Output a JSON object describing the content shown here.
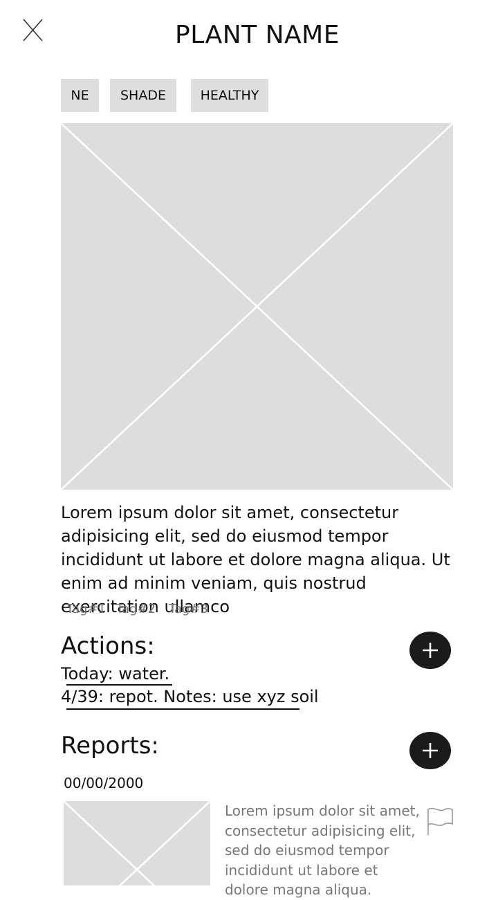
{
  "header": {
    "title": "PLANT NAME",
    "close_icon": "close-icon"
  },
  "status_chips": [
    "NE",
    "SHADE",
    "HEALTHY"
  ],
  "description": "Lorem ipsum dolor sit amet, consectetur adipisicing elit, sed do eiusmod tempor incididunt ut labore et dolore magna aliqua. Ut enim ad minim veniam, quis nostrud exercitation ullamco",
  "tags": [
    "Tag#1",
    "Tag#2",
    "Tag#3"
  ],
  "actions": {
    "title": "Actions:",
    "add_icon": "plus-icon",
    "items": [
      "Today: water.",
      "4/39: repot. Notes: use xyz soil"
    ]
  },
  "reports": {
    "title": "Reports:",
    "add_icon": "plus-icon",
    "items": [
      {
        "date": "00/00/2000",
        "text": "Lorem ipsum dolor sit amet, consectetur adipisicing elit, sed do eiusmod tempor incididunt ut labore et dolore magna aliqua.",
        "flag_icon": "flag-icon"
      }
    ]
  },
  "colors": {
    "placeholder": "#dddddd",
    "chip": "#dedede",
    "button": "#1b1b1b",
    "muted_text": "#777777"
  }
}
